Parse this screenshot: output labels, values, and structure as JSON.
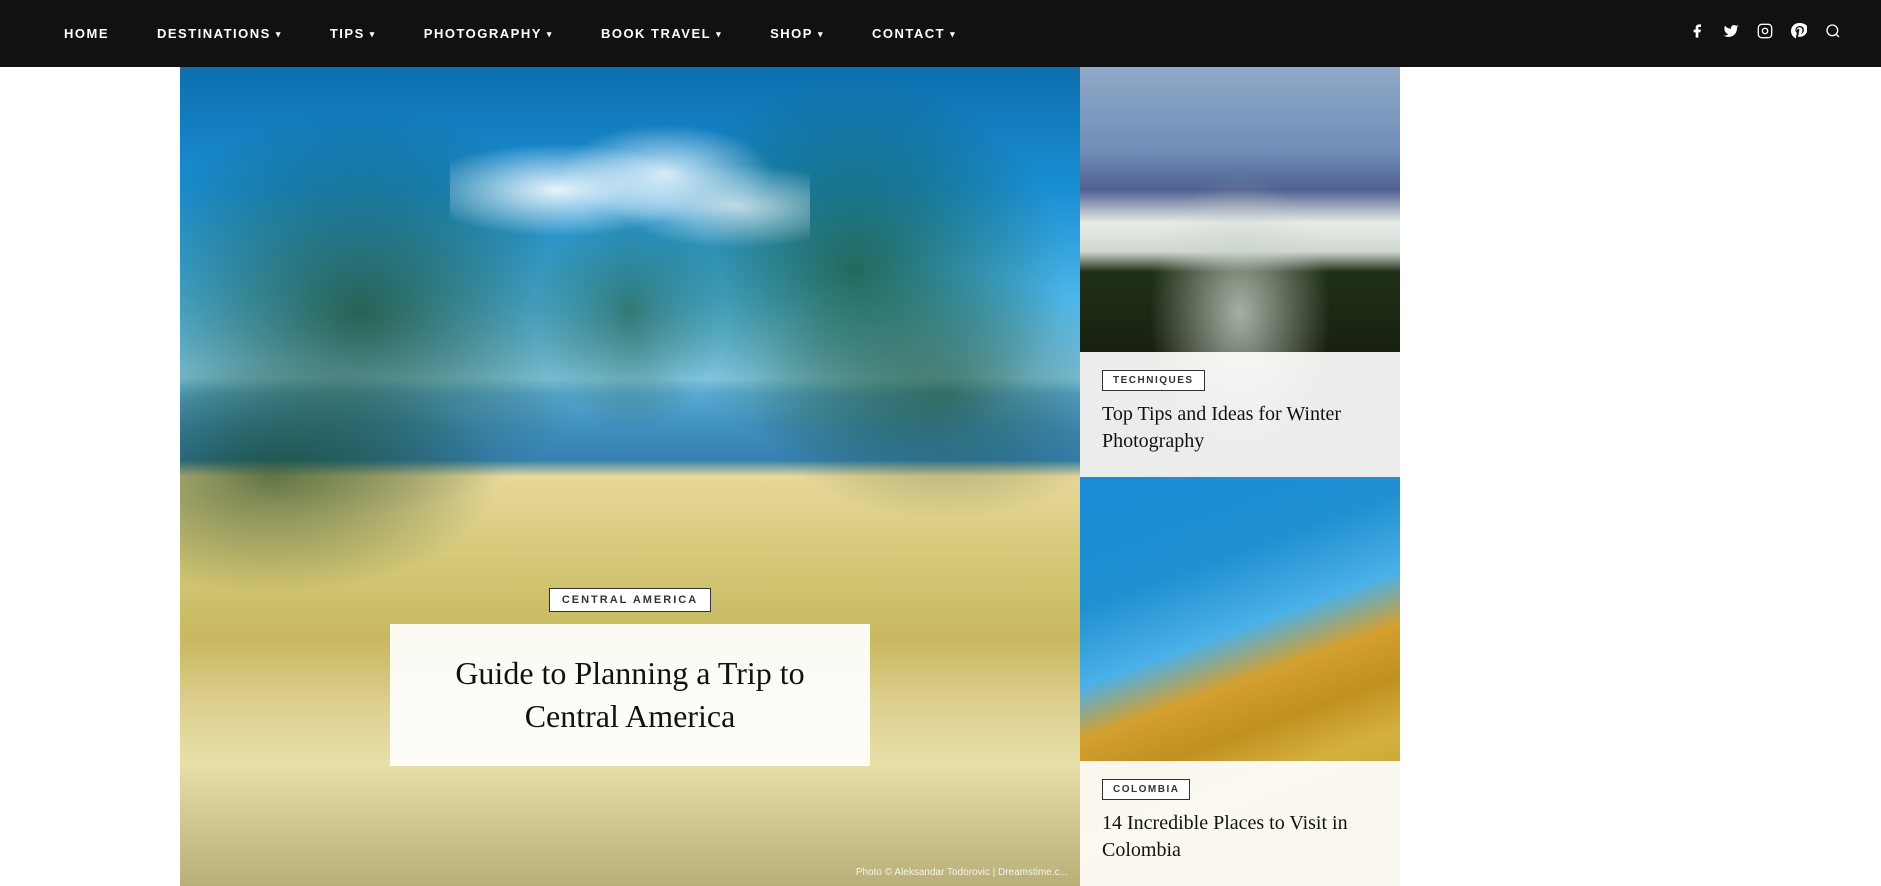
{
  "nav": {
    "items": [
      {
        "id": "home",
        "label": "HOME",
        "hasDropdown": false
      },
      {
        "id": "destinations",
        "label": "DESTINATIONS",
        "hasDropdown": true
      },
      {
        "id": "tips",
        "label": "TIPS",
        "hasDropdown": true
      },
      {
        "id": "photography",
        "label": "PHOTOGRAPHY",
        "hasDropdown": true
      },
      {
        "id": "book-travel",
        "label": "BOOK TRAVEL",
        "hasDropdown": true
      },
      {
        "id": "shop",
        "label": "SHOP",
        "hasDropdown": true
      },
      {
        "id": "contact",
        "label": "CONTACT",
        "hasDropdown": true
      }
    ],
    "social": [
      {
        "id": "facebook",
        "icon": "f",
        "label": "facebook-icon"
      },
      {
        "id": "twitter",
        "icon": "𝕏",
        "label": "twitter-icon"
      },
      {
        "id": "instagram",
        "icon": "◻",
        "label": "instagram-icon"
      },
      {
        "id": "pinterest",
        "icon": "𝗣",
        "label": "pinterest-icon"
      }
    ]
  },
  "hero": {
    "category": "CENTRAL AMERICA",
    "title": "Guide to Planning a Trip to Central America",
    "photo_credit": "Photo © Aleksandar Todorovic | Dreamstime.c..."
  },
  "card1": {
    "badge": "TECHNIQUES",
    "title": "Top Tips and Ideas for Winter Photography"
  },
  "card2": {
    "badge": "COLOMBIA",
    "title": "14 Incredible Places to Visit in Colombia"
  }
}
